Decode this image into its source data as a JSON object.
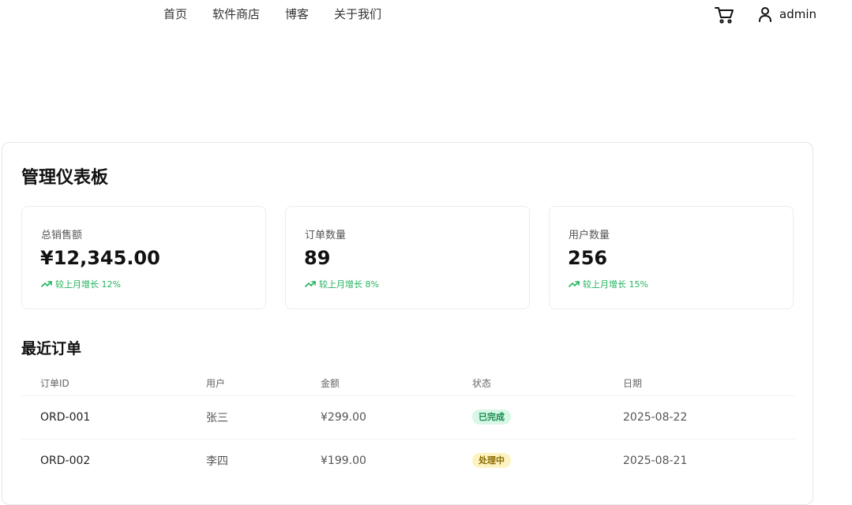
{
  "nav": {
    "links": [
      "首页",
      "软件商店",
      "博客",
      "关于我们"
    ],
    "cart_icon": "shopping-cart-icon",
    "user_icon": "user-icon",
    "username": "admin"
  },
  "dashboard": {
    "title": "管理仪表板",
    "stats": [
      {
        "label": "总销售额",
        "value": "¥12,345.00",
        "trend": "较上月增长 12%"
      },
      {
        "label": "订单数量",
        "value": "89",
        "trend": "较上月增长 8%"
      },
      {
        "label": "用户数量",
        "value": "256",
        "trend": "较上月增长 15%"
      }
    ],
    "trend_color": "#22b35e"
  },
  "orders": {
    "title": "最近订单",
    "columns": [
      "订单ID",
      "用户",
      "金额",
      "状态",
      "日期"
    ],
    "rows": [
      {
        "id": "ORD-001",
        "user": "张三",
        "amount": "¥299.00",
        "status": "已完成",
        "date": "2025-08-22"
      },
      {
        "id": "ORD-002",
        "user": "李四",
        "amount": "¥199.00",
        "status": "处理中",
        "date": "2025-08-21"
      }
    ]
  }
}
